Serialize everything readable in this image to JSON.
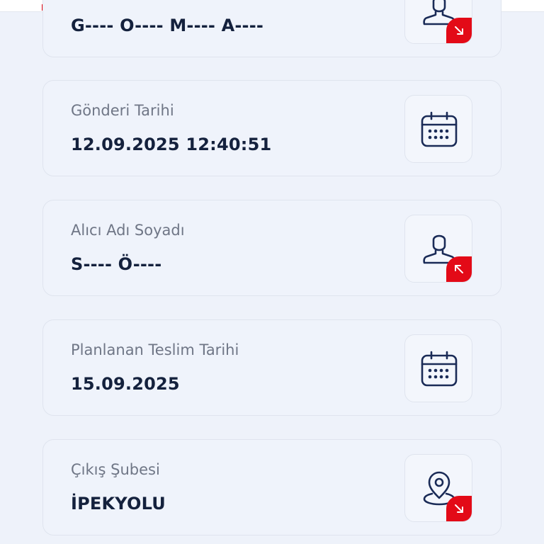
{
  "cards": [
    {
      "label": "",
      "value": "G---- O---- M---- A----",
      "icon": "person-icon",
      "badge": "arrow-down-right-icon"
    },
    {
      "label": "Gönderi Tarihi",
      "value": "12.09.2025 12:40:51",
      "icon": "calendar-icon"
    },
    {
      "label": "Alıcı Adı Soyadı",
      "value": "S---- Ö----",
      "icon": "person-icon",
      "badge": "arrow-up-left-icon"
    },
    {
      "label": "Planlanan Teslim Tarihi",
      "value": "15.09.2025",
      "icon": "calendar-icon"
    },
    {
      "label": "Çıkış Şubesi",
      "value": "İPEKYOLU",
      "icon": "location-pin-icon",
      "badge": "arrow-down-right-icon"
    }
  ],
  "colors": {
    "accent": "#e30a17",
    "icon": "#1a2b57",
    "text_primary": "#14213d",
    "text_secondary": "#6f7686",
    "background": "#eef2fa"
  }
}
